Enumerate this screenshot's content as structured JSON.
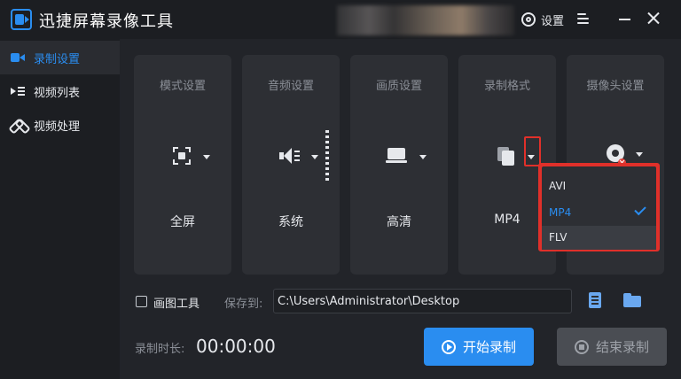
{
  "app": {
    "title": "迅捷屏幕录像工具"
  },
  "titlebar": {
    "settings_label": "设置"
  },
  "sidebar": {
    "items": [
      {
        "label": "录制设置",
        "icon": "record-settings-icon",
        "active": true
      },
      {
        "label": "视频列表",
        "icon": "video-list-icon",
        "active": false
      },
      {
        "label": "视频处理",
        "icon": "video-process-icon",
        "active": false
      }
    ]
  },
  "cards": {
    "mode": {
      "title": "模式设置",
      "value": "全屏",
      "icon": "fullscreen-icon"
    },
    "audio": {
      "title": "音频设置",
      "value": "系统",
      "icon": "speaker-icon"
    },
    "quality": {
      "title": "画质设置",
      "value": "高清",
      "icon": "hd-icon"
    },
    "format": {
      "title": "录制格式",
      "value": "MP4",
      "icon": "file-icon"
    },
    "camera": {
      "title": "摄像头设置",
      "icon": "camera-icon"
    }
  },
  "format_dropdown": {
    "options": [
      "AVI",
      "MP4",
      "FLV"
    ],
    "selected": "MP4",
    "highlighted": "FLV"
  },
  "controls": {
    "draw_tool_label": "画图工具",
    "draw_tool_checked": false,
    "save_to_label": "保存到:",
    "save_path": "C:\\Users\\Administrator\\Desktop",
    "duration_label": "录制时长:",
    "duration_value": "00:00:00",
    "start_label": "开始录制",
    "stop_label": "结束录制"
  },
  "colors": {
    "accent": "#2a8df0",
    "highlight_red": "#e0302a",
    "background": "#222429",
    "card": "#2d2f34"
  }
}
